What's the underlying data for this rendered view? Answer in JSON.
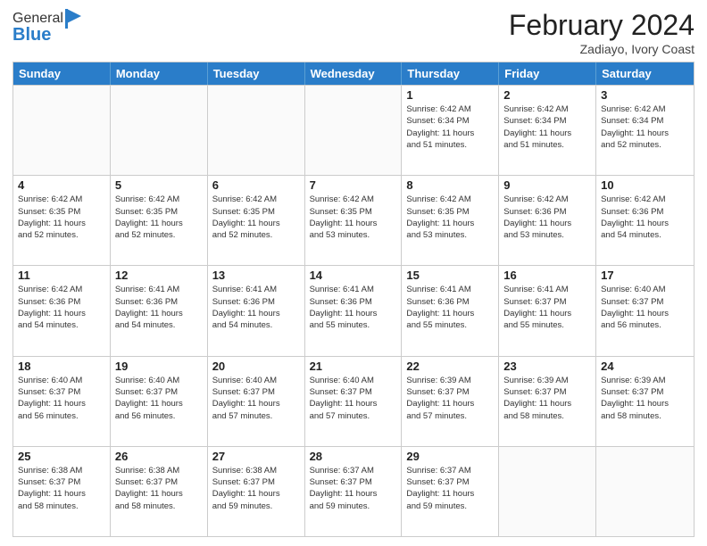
{
  "header": {
    "logo_general": "General",
    "logo_blue": "Blue",
    "title": "February 2024",
    "subtitle": "Zadiayo, Ivory Coast"
  },
  "days_of_week": [
    "Sunday",
    "Monday",
    "Tuesday",
    "Wednesday",
    "Thursday",
    "Friday",
    "Saturday"
  ],
  "weeks": [
    [
      {
        "day": "",
        "info": "",
        "empty": true
      },
      {
        "day": "",
        "info": "",
        "empty": true
      },
      {
        "day": "",
        "info": "",
        "empty": true
      },
      {
        "day": "",
        "info": "",
        "empty": true
      },
      {
        "day": "1",
        "info": "Sunrise: 6:42 AM\nSunset: 6:34 PM\nDaylight: 11 hours\nand 51 minutes."
      },
      {
        "day": "2",
        "info": "Sunrise: 6:42 AM\nSunset: 6:34 PM\nDaylight: 11 hours\nand 51 minutes."
      },
      {
        "day": "3",
        "info": "Sunrise: 6:42 AM\nSunset: 6:34 PM\nDaylight: 11 hours\nand 52 minutes."
      }
    ],
    [
      {
        "day": "4",
        "info": "Sunrise: 6:42 AM\nSunset: 6:35 PM\nDaylight: 11 hours\nand 52 minutes."
      },
      {
        "day": "5",
        "info": "Sunrise: 6:42 AM\nSunset: 6:35 PM\nDaylight: 11 hours\nand 52 minutes."
      },
      {
        "day": "6",
        "info": "Sunrise: 6:42 AM\nSunset: 6:35 PM\nDaylight: 11 hours\nand 52 minutes."
      },
      {
        "day": "7",
        "info": "Sunrise: 6:42 AM\nSunset: 6:35 PM\nDaylight: 11 hours\nand 53 minutes."
      },
      {
        "day": "8",
        "info": "Sunrise: 6:42 AM\nSunset: 6:35 PM\nDaylight: 11 hours\nand 53 minutes."
      },
      {
        "day": "9",
        "info": "Sunrise: 6:42 AM\nSunset: 6:36 PM\nDaylight: 11 hours\nand 53 minutes."
      },
      {
        "day": "10",
        "info": "Sunrise: 6:42 AM\nSunset: 6:36 PM\nDaylight: 11 hours\nand 54 minutes."
      }
    ],
    [
      {
        "day": "11",
        "info": "Sunrise: 6:42 AM\nSunset: 6:36 PM\nDaylight: 11 hours\nand 54 minutes."
      },
      {
        "day": "12",
        "info": "Sunrise: 6:41 AM\nSunset: 6:36 PM\nDaylight: 11 hours\nand 54 minutes."
      },
      {
        "day": "13",
        "info": "Sunrise: 6:41 AM\nSunset: 6:36 PM\nDaylight: 11 hours\nand 54 minutes."
      },
      {
        "day": "14",
        "info": "Sunrise: 6:41 AM\nSunset: 6:36 PM\nDaylight: 11 hours\nand 55 minutes."
      },
      {
        "day": "15",
        "info": "Sunrise: 6:41 AM\nSunset: 6:36 PM\nDaylight: 11 hours\nand 55 minutes."
      },
      {
        "day": "16",
        "info": "Sunrise: 6:41 AM\nSunset: 6:37 PM\nDaylight: 11 hours\nand 55 minutes."
      },
      {
        "day": "17",
        "info": "Sunrise: 6:40 AM\nSunset: 6:37 PM\nDaylight: 11 hours\nand 56 minutes."
      }
    ],
    [
      {
        "day": "18",
        "info": "Sunrise: 6:40 AM\nSunset: 6:37 PM\nDaylight: 11 hours\nand 56 minutes."
      },
      {
        "day": "19",
        "info": "Sunrise: 6:40 AM\nSunset: 6:37 PM\nDaylight: 11 hours\nand 56 minutes."
      },
      {
        "day": "20",
        "info": "Sunrise: 6:40 AM\nSunset: 6:37 PM\nDaylight: 11 hours\nand 57 minutes."
      },
      {
        "day": "21",
        "info": "Sunrise: 6:40 AM\nSunset: 6:37 PM\nDaylight: 11 hours\nand 57 minutes."
      },
      {
        "day": "22",
        "info": "Sunrise: 6:39 AM\nSunset: 6:37 PM\nDaylight: 11 hours\nand 57 minutes."
      },
      {
        "day": "23",
        "info": "Sunrise: 6:39 AM\nSunset: 6:37 PM\nDaylight: 11 hours\nand 58 minutes."
      },
      {
        "day": "24",
        "info": "Sunrise: 6:39 AM\nSunset: 6:37 PM\nDaylight: 11 hours\nand 58 minutes."
      }
    ],
    [
      {
        "day": "25",
        "info": "Sunrise: 6:38 AM\nSunset: 6:37 PM\nDaylight: 11 hours\nand 58 minutes."
      },
      {
        "day": "26",
        "info": "Sunrise: 6:38 AM\nSunset: 6:37 PM\nDaylight: 11 hours\nand 58 minutes."
      },
      {
        "day": "27",
        "info": "Sunrise: 6:38 AM\nSunset: 6:37 PM\nDaylight: 11 hours\nand 59 minutes."
      },
      {
        "day": "28",
        "info": "Sunrise: 6:37 AM\nSunset: 6:37 PM\nDaylight: 11 hours\nand 59 minutes."
      },
      {
        "day": "29",
        "info": "Sunrise: 6:37 AM\nSunset: 6:37 PM\nDaylight: 11 hours\nand 59 minutes."
      },
      {
        "day": "",
        "info": "",
        "empty": true
      },
      {
        "day": "",
        "info": "",
        "empty": true
      }
    ]
  ]
}
